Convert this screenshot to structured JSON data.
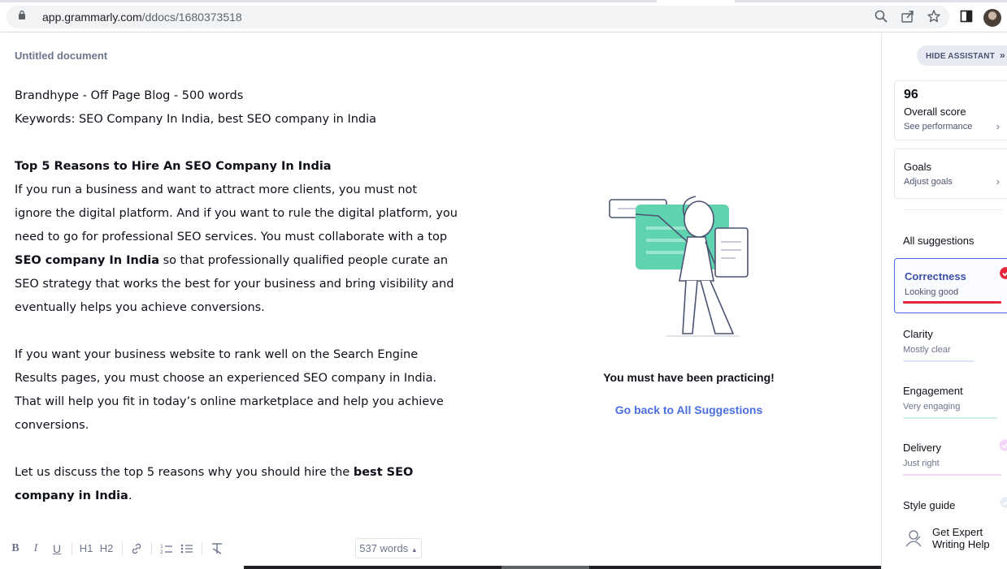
{
  "browser": {
    "url_host": "app.grammarly.com",
    "url_path": "/ddocs/1680373518"
  },
  "document": {
    "title": "Untitled document",
    "line1": "Brandhype - Off Page Blog - 500 words",
    "line2": "Keywords: SEO Company In India, best SEO company in India",
    "heading": "Top 5 Reasons to Hire An SEO Company In India",
    "p1_a": "If you run a business and want to attract more clients, you must not ignore the digital platform. And if you want to rule the digital platform, you need to go for professional SEO services. You must collaborate with a top ",
    "p1_bold": "SEO company In India",
    "p1_b": " so that professionally qualified people curate an SEO strategy that works the best for your business and bring visibility and eventually helps you achieve conversions.",
    "p2": "If you want your business website to rank well on the Search Engine Results pages, you must choose an experienced SEO company in India. That will help you fit in today’s online marketplace and help you achieve conversions.",
    "p3_a": "Let us discuss the top 5 reasons why you should hire the ",
    "p3_bold": "best SEO company in India",
    "p3_b": "."
  },
  "center": {
    "message": "You must have been practicing!",
    "link": "Go back to All Suggestions"
  },
  "toolbar": {
    "bold": "B",
    "italic": "I",
    "underline": "U",
    "h1": "H1",
    "h2": "H2",
    "word_count": "537 words"
  },
  "sidebar": {
    "hide_label": "HIDE ASSISTANT",
    "score": {
      "value": "96",
      "label": "Overall score",
      "link": "See performance"
    },
    "goals": {
      "label": "Goals",
      "link": "Adjust goals"
    },
    "all_suggestions": "All suggestions",
    "categories": [
      {
        "name": "Correctness",
        "status": "Looking good",
        "color": "#e7273e"
      },
      {
        "name": "Clarity",
        "status": "Mostly clear",
        "color": "#4a6ee0"
      },
      {
        "name": "Engagement",
        "status": "Very engaging",
        "color": "#15c39a"
      },
      {
        "name": "Delivery",
        "status": "Just right",
        "color": "#d048e5"
      }
    ],
    "style_guide": "Style guide",
    "expert": "Get Expert Writing Help"
  }
}
